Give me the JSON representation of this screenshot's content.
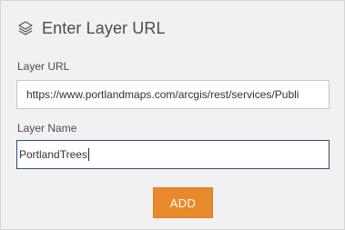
{
  "dialog": {
    "title": "Enter Layer URL",
    "title_icon": "layers-icon"
  },
  "form": {
    "url_label": "Layer URL",
    "url_value": "https://www.portlandmaps.com/arcgis/rest/services/Publi",
    "name_label": "Layer Name",
    "name_value": "PortlandTrees",
    "add_label": "ADD"
  },
  "colors": {
    "accent_button": "#e8892c",
    "focus_border": "#29517c",
    "background": "#f1f1f1"
  }
}
